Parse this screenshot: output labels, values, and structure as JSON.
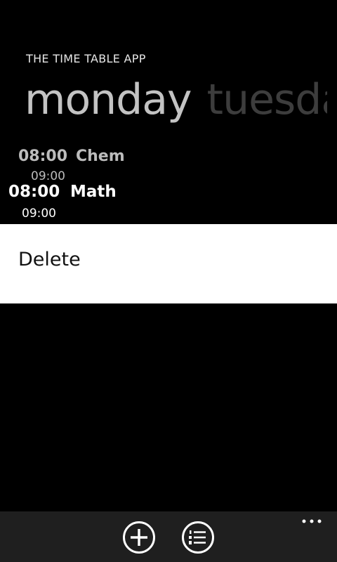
{
  "app": {
    "title": "THE TIME TABLE APP"
  },
  "pivot": {
    "items": [
      {
        "label": "monday"
      },
      {
        "label": "tuesday"
      }
    ]
  },
  "schedule": {
    "entries": [
      {
        "start": "08:00",
        "subject": "Chem",
        "end": "09:00"
      },
      {
        "start": "08:00",
        "subject": "Math",
        "end": "09:00"
      }
    ]
  },
  "context_menu": {
    "items": [
      {
        "label": "Delete"
      }
    ]
  },
  "app_bar": {
    "buttons": [
      {
        "icon": "add-icon"
      },
      {
        "icon": "numbered-list-icon"
      }
    ],
    "more_icon": "more-icon"
  }
}
